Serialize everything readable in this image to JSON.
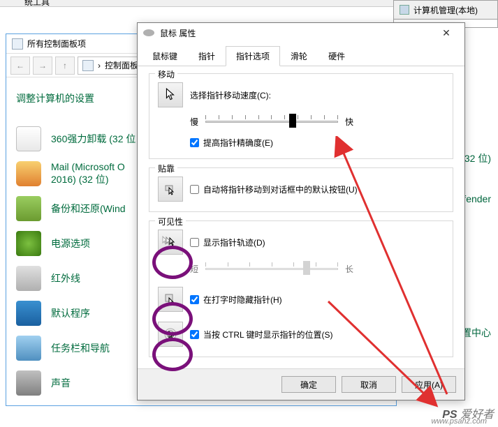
{
  "topbar": {
    "label": "统工具"
  },
  "rightpanel": {
    "label": "计算机管理(本地)"
  },
  "rightside": {
    "a": "(32 位)",
    "b": "efender",
    "c": "置中心"
  },
  "ctrlpanel": {
    "title": "所有控制面板项",
    "path": "控制面板",
    "heading": "调整计算机的设置",
    "items": [
      {
        "label": "360强力卸载 (32 位"
      },
      {
        "label": "Mail (Microsoft O\n2016) (32 位)"
      },
      {
        "label": "备份和还原(Wind"
      },
      {
        "label": "电源选项"
      },
      {
        "label": "红外线"
      },
      {
        "label": "默认程序"
      },
      {
        "label": "任务栏和导航"
      },
      {
        "label": "声音"
      }
    ]
  },
  "dialog": {
    "title": "鼠标 属性",
    "tabs": [
      "鼠标键",
      "指针",
      "指针选项",
      "滑轮",
      "硬件"
    ],
    "active_tab": 2,
    "motion": {
      "title": "移动",
      "label": "选择指针移动速度(C):",
      "slow": "慢",
      "fast": "快",
      "precision": "提高指针精确度(E)"
    },
    "snapto": {
      "title": "贴靠",
      "label": "自动将指针移动到对话框中的默认按钮(U)"
    },
    "visibility": {
      "title": "可见性",
      "trails": "显示指针轨迹(D)",
      "short": "短",
      "long": "长",
      "hide": "在打字时隐藏指针(H)",
      "ctrl": "当按 CTRL 键时显示指针的位置(S)"
    },
    "buttons": {
      "ok": "确定",
      "cancel": "取消",
      "apply": "应用(A)"
    }
  },
  "watermark": {
    "brand": "PS 爱好者",
    "url": "www.psahz.com"
  }
}
